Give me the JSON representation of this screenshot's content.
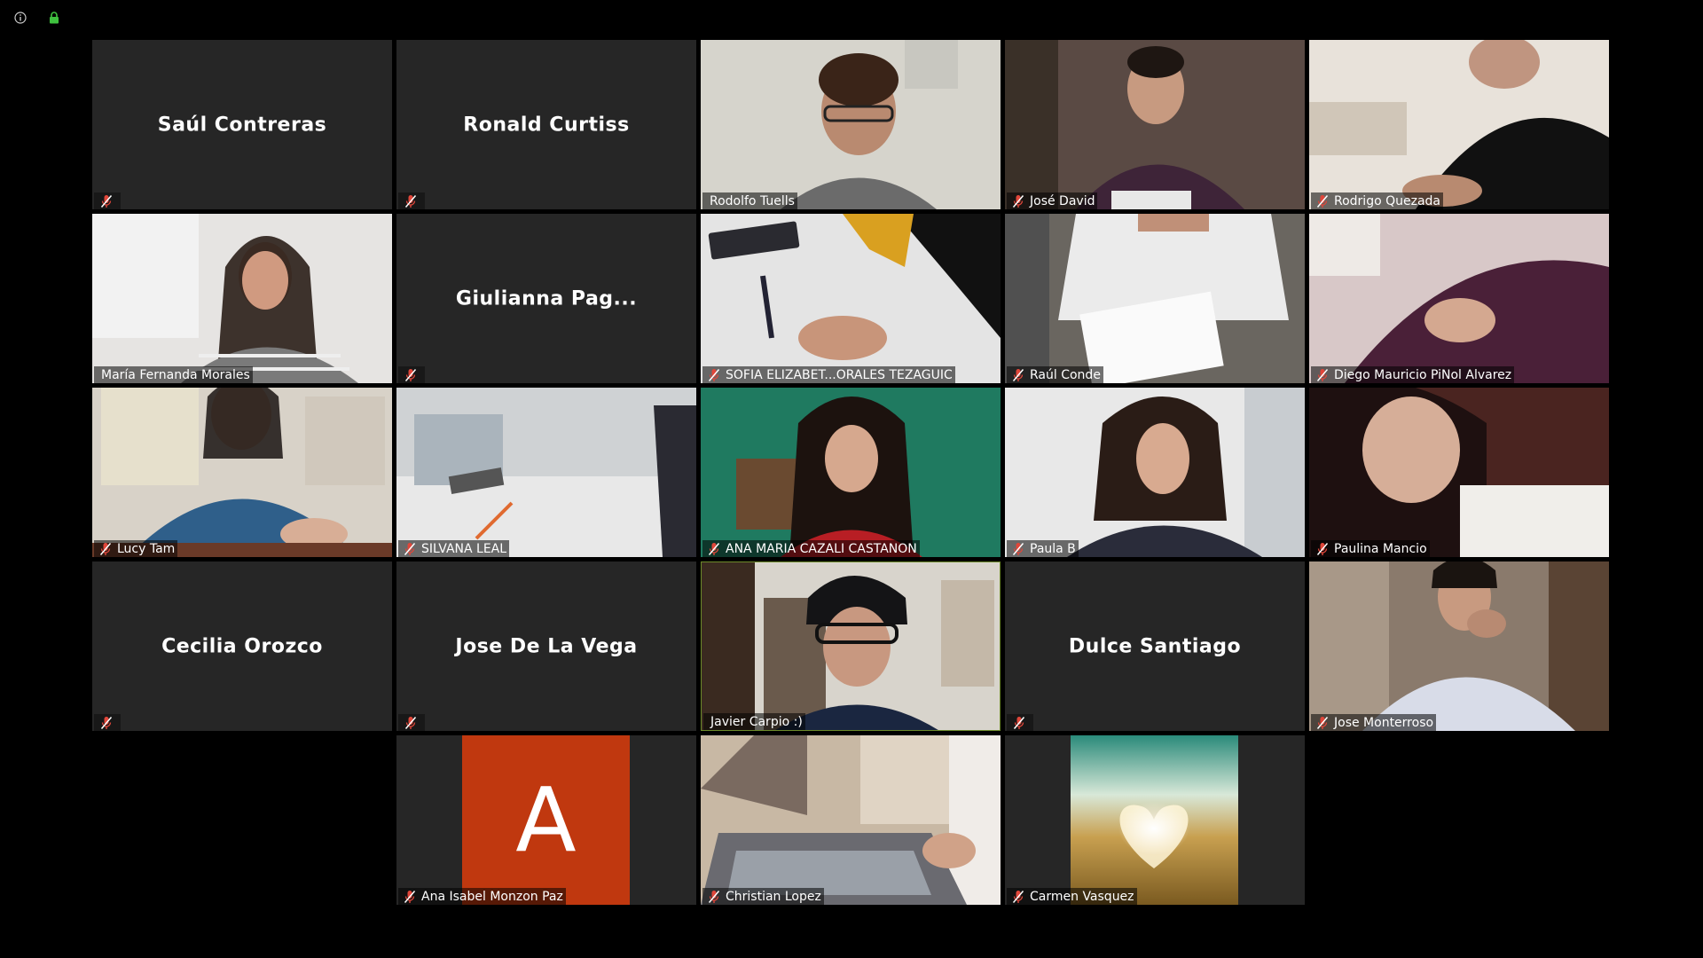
{
  "colors": {
    "background": "#000000",
    "tile": "#262626",
    "speaker_border": "#dfe86a",
    "muted_mic": "#e0463a",
    "avatar_bg": "#c0380f",
    "lock": "#3fc23f"
  },
  "topbar": {
    "icons": [
      "info-icon",
      "lock-icon"
    ]
  },
  "participants": [
    {
      "id": "p1",
      "name": "Saúl Contreras",
      "video": false,
      "muted": true
    },
    {
      "id": "p2",
      "name": "Ronald Curtiss",
      "video": false,
      "muted": true
    },
    {
      "id": "p3",
      "name": "Rodolfo Tuells",
      "video": true,
      "muted": false
    },
    {
      "id": "p4",
      "name": "José David",
      "video": true,
      "muted": true
    },
    {
      "id": "p5",
      "name": "Rodrigo Quezada",
      "video": true,
      "muted": true
    },
    {
      "id": "p6",
      "name": "María Fernanda Morales",
      "video": true,
      "muted": false
    },
    {
      "id": "p7",
      "name": "Giulianna Pag...",
      "video": false,
      "muted": true
    },
    {
      "id": "p8",
      "name": "SOFIA ELIZABET...ORALES TEZAGUIC",
      "video": true,
      "muted": true
    },
    {
      "id": "p9",
      "name": "Raúl Conde",
      "video": true,
      "muted": true
    },
    {
      "id": "p10",
      "name": "Diego Mauricio PiNol Alvarez",
      "video": true,
      "muted": true
    },
    {
      "id": "p11",
      "name": "Lucy Tam",
      "video": true,
      "muted": true
    },
    {
      "id": "p12",
      "name": "SILVANA LEAL",
      "video": true,
      "muted": true
    },
    {
      "id": "p13",
      "name": "ANA MARIA CAZALI CASTANON",
      "video": true,
      "muted": true
    },
    {
      "id": "p14",
      "name": "Paula B",
      "video": true,
      "muted": true
    },
    {
      "id": "p15",
      "name": "Paulina Mancio",
      "video": true,
      "muted": true
    },
    {
      "id": "p16",
      "name": "Cecilia Orozco",
      "video": false,
      "muted": true
    },
    {
      "id": "p17",
      "name": "Jose De La Vega",
      "video": false,
      "muted": true
    },
    {
      "id": "p18",
      "name": "Javier Carpio :)",
      "video": true,
      "muted": false,
      "speaking": true
    },
    {
      "id": "p19",
      "name": "Dulce Santiago",
      "video": false,
      "muted": true
    },
    {
      "id": "p20",
      "name": "Jose Monterroso",
      "video": true,
      "muted": true
    },
    {
      "id": "p21",
      "name": "Ana Isabel Monzon Paz",
      "video": false,
      "muted": true,
      "avatar_letter": "A"
    },
    {
      "id": "p22",
      "name": "Christian Lopez",
      "video": true,
      "muted": true
    },
    {
      "id": "p23",
      "name": "Carmen Vasquez",
      "video": false,
      "muted": true,
      "profile_photo": true
    }
  ]
}
